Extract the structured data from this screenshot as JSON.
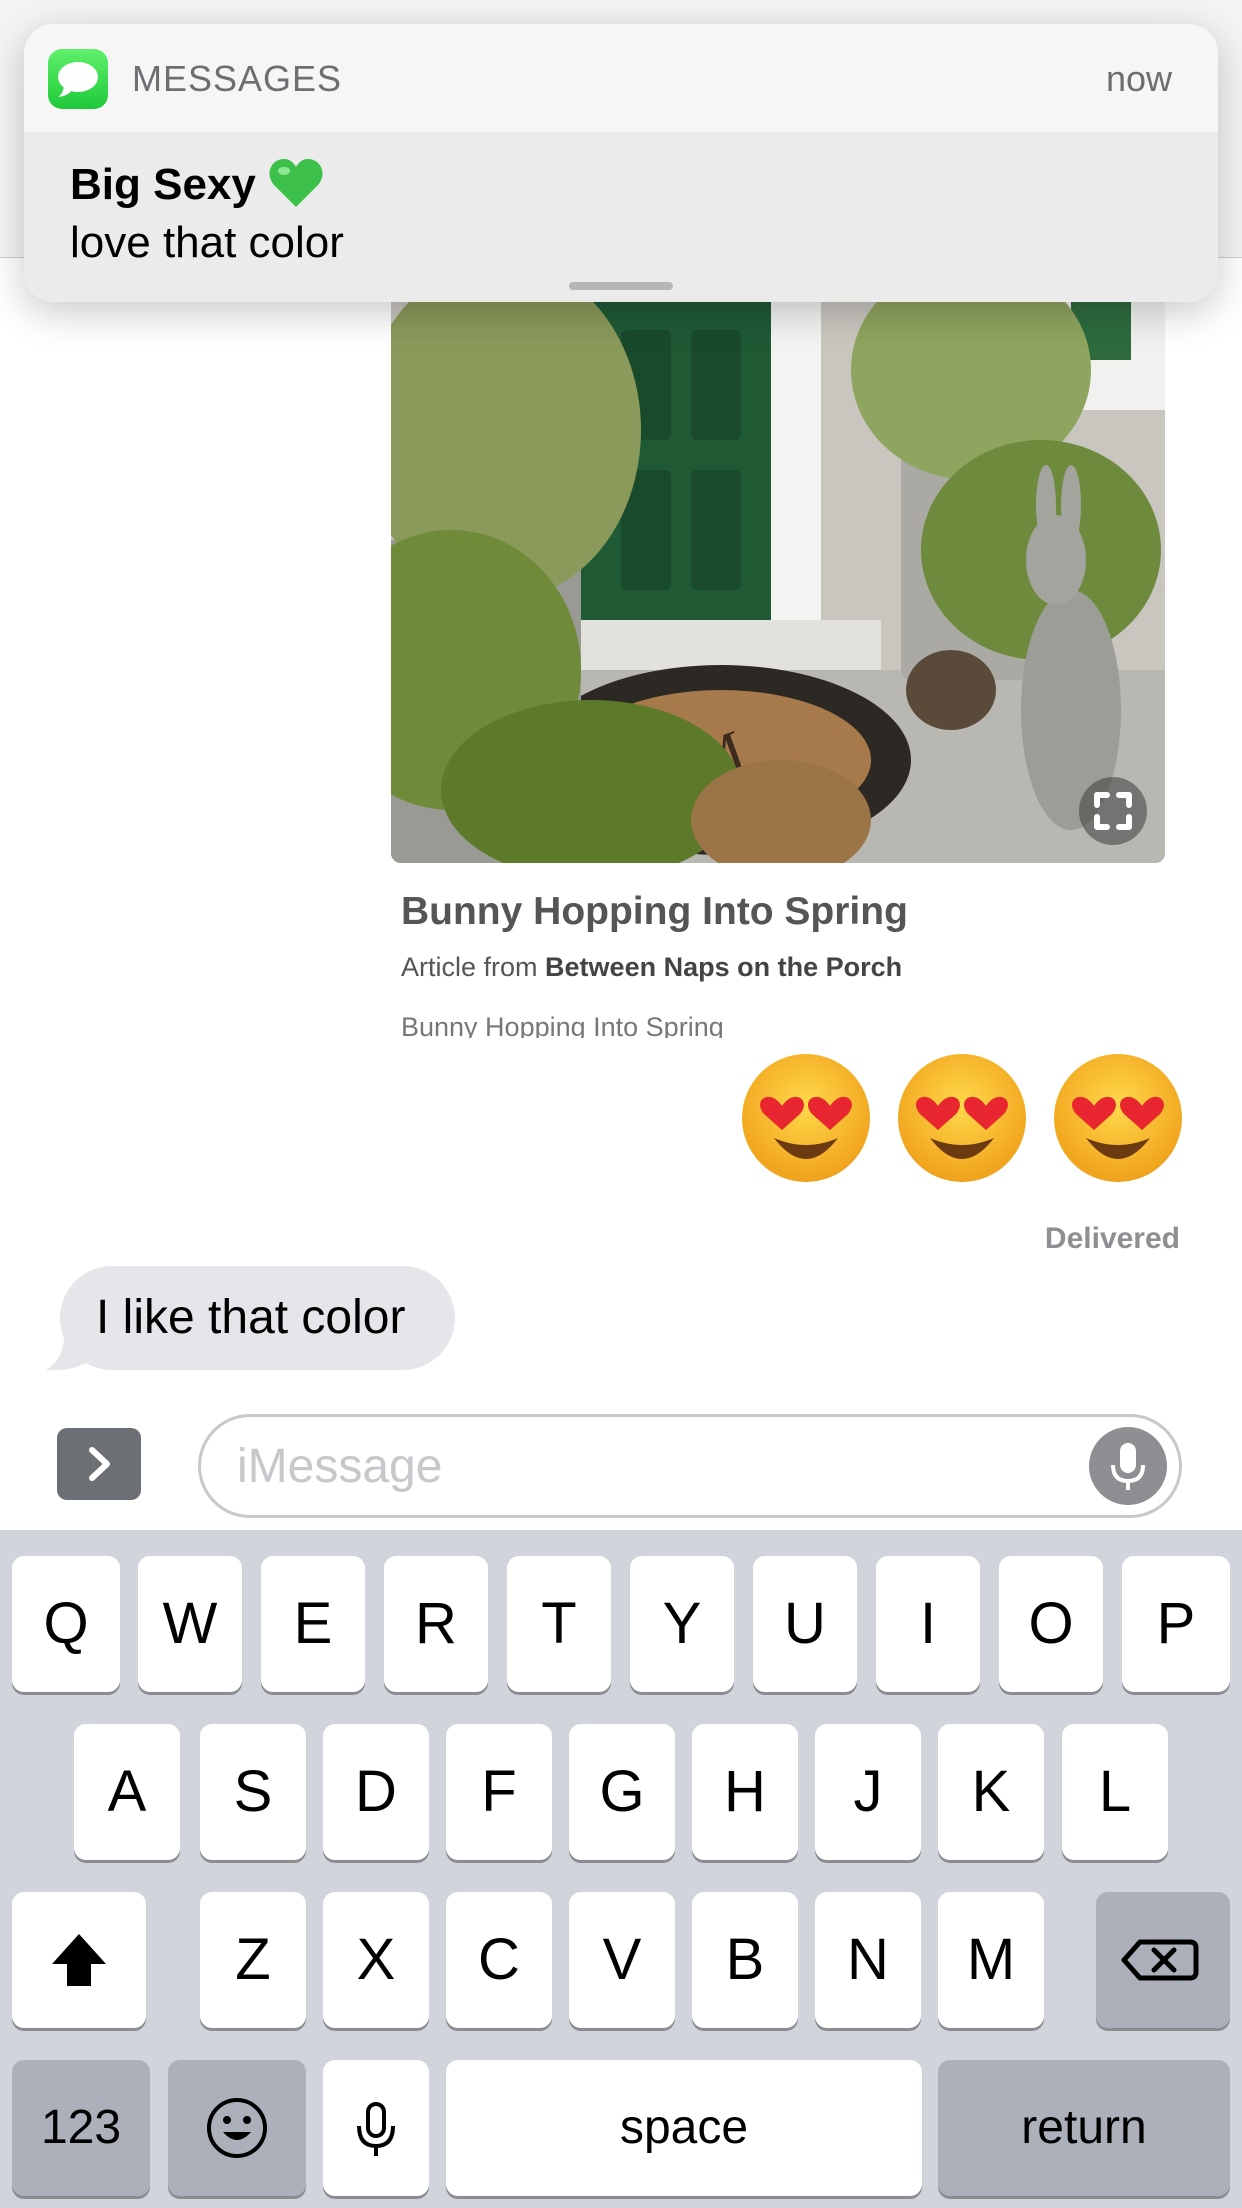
{
  "notification": {
    "app_name": "MESSAGES",
    "time": "now",
    "sender": "Big Sexy",
    "sender_emoji": "green-heart",
    "message": "love that color"
  },
  "link_preview": {
    "title": "Bunny Hopping Into Spring",
    "source_prefix": "Article from",
    "source_name": "Between Naps on the Porch",
    "description": "Bunny Hopping Into Spring"
  },
  "emoji_message": [
    "heart-eyes-emoji",
    "heart-eyes-emoji",
    "heart-eyes-emoji"
  ],
  "status": "Delivered",
  "incoming_bubble": "I like that color",
  "composer": {
    "placeholder": "iMessage"
  },
  "keyboard": {
    "row1": [
      "Q",
      "W",
      "E",
      "R",
      "T",
      "Y",
      "U",
      "I",
      "O",
      "P"
    ],
    "row2": [
      "A",
      "S",
      "D",
      "F",
      "G",
      "H",
      "J",
      "K",
      "L"
    ],
    "row3": [
      "Z",
      "X",
      "C",
      "V",
      "B",
      "N",
      "M"
    ],
    "numbers_label": "123",
    "space_label": "space",
    "return_label": "return"
  },
  "colors": {
    "bubble_gray": "#e5e5ea",
    "keyboard_bg": "#d1d4db",
    "messages_green": "#34c759",
    "door_green": "#1f5a35"
  }
}
